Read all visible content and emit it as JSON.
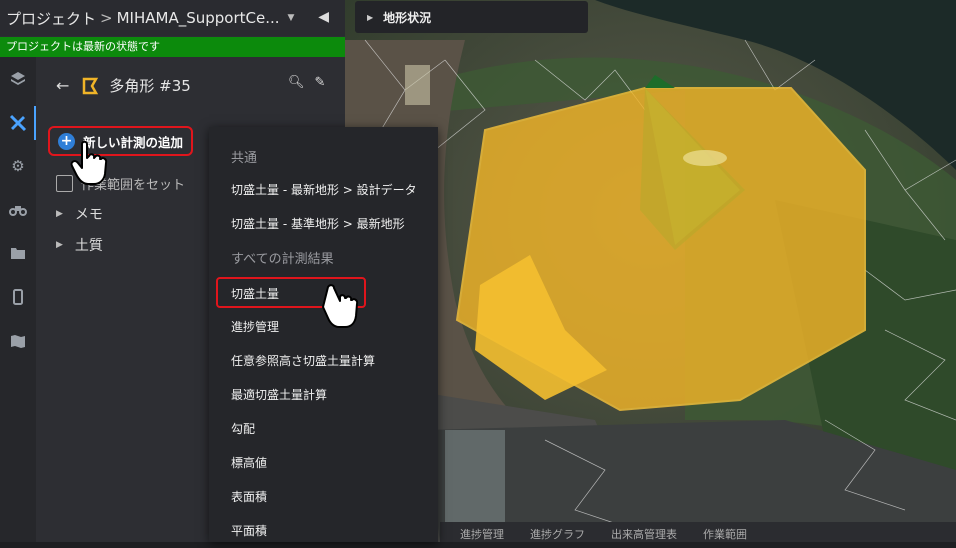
{
  "header": {
    "breadcrumb_root": "プロジェクト",
    "separator": ">",
    "project_name": "MIHAMA_SupportCe..."
  },
  "status_message": "プロジェクトは最新の状態です",
  "rail_icons": [
    "layers-icon",
    "measure-icon",
    "gear-icon",
    "drone-icon",
    "folder-icon",
    "mobile-icon",
    "map-icon"
  ],
  "polygon": {
    "title": "多角形 #35"
  },
  "add_measurement_label": "新しい計測の追加",
  "checkbox_label": "作業範囲をセット",
  "tree_items": [
    "メモ",
    "土質"
  ],
  "map": {
    "terrain_tab": "地形状況",
    "bottom_tabs": [
      "進捗管理",
      "進捗グラフ",
      "出来高管理表",
      "作業範囲"
    ]
  },
  "menu": {
    "section_common": "共通",
    "common_items": [
      "切盛土量 - 最新地形 > 設計データ",
      "切盛土量 - 基準地形 > 最新地形"
    ],
    "section_all": "すべての計測結果",
    "all_items": [
      "切盛土量",
      "進捗管理",
      "任意参照高さ切盛土量計算",
      "最適切盛土量計算",
      "勾配",
      "標高値",
      "表面積",
      "平面積"
    ]
  },
  "colors": {
    "accent": "#4aa3ff",
    "status_green": "#0c8a0c",
    "highlight_red": "#e0151c",
    "polygon_fill": "#f0b428"
  }
}
